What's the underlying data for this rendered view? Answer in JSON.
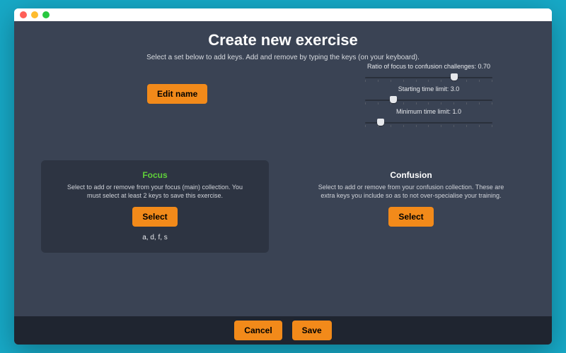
{
  "header": {
    "title": "Create new exercise",
    "subtitle": "Select a set below to add keys. Add and remove by typing the keys (on your keyboard)."
  },
  "editNameLabel": "Edit name",
  "sliders": {
    "ratio": {
      "label": "Ratio of focus to confusion challenges: 0.70",
      "position": 70
    },
    "startTime": {
      "label": "Starting time limit: 3.0",
      "position": 22
    },
    "minTime": {
      "label": "Minimum time limit: 1.0",
      "position": 12
    }
  },
  "focus": {
    "title": "Focus",
    "desc": "Select to add or remove from your focus (main) collection. You must select at least 2 keys to save this exercise.",
    "selectLabel": "Select",
    "keys": "a, d, f, s"
  },
  "confusion": {
    "title": "Confusion",
    "desc": "Select to add or remove from your confusion collection. These are extra keys you include so as to not over-specialise your training.",
    "selectLabel": "Select"
  },
  "footer": {
    "cancel": "Cancel",
    "save": "Save"
  }
}
